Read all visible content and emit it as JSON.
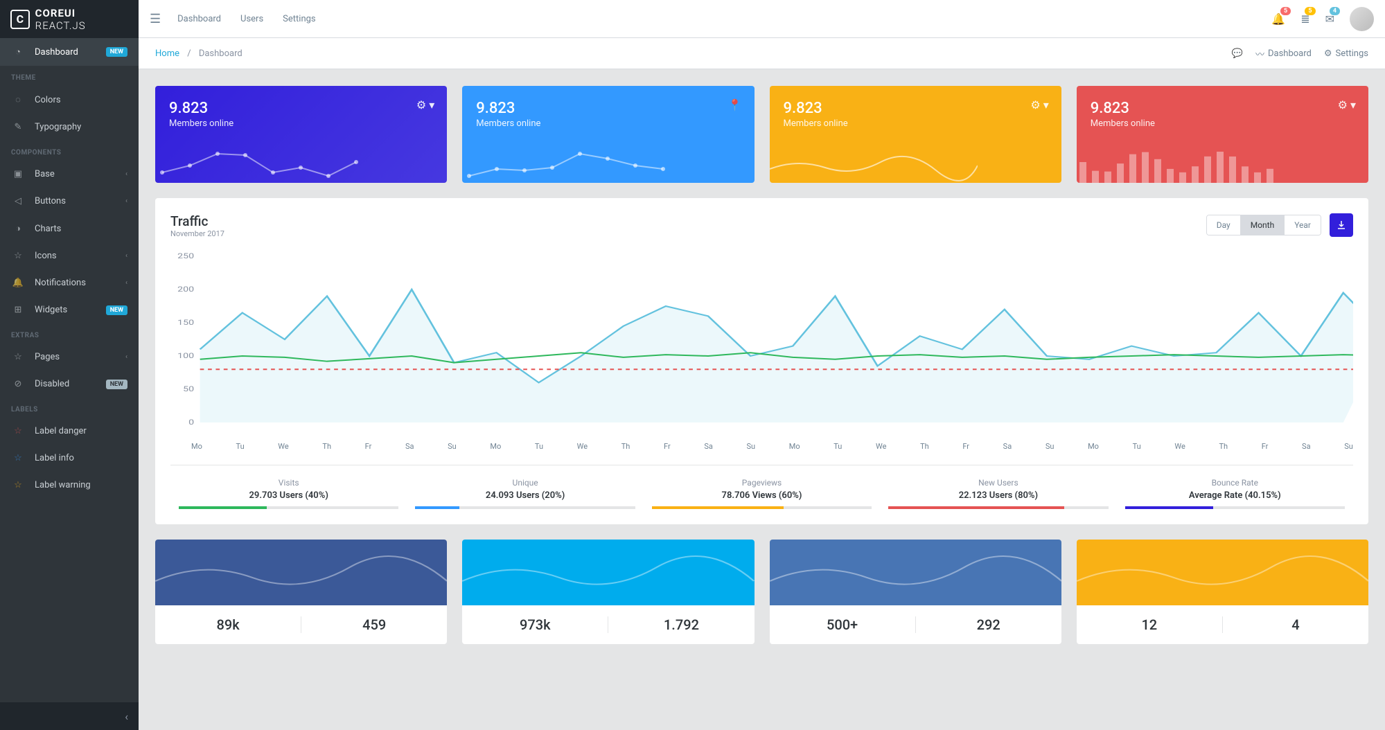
{
  "brand": {
    "main": "COREUI",
    "sub": "REACT.JS"
  },
  "headerNav": [
    "Dashboard",
    "Users",
    "Settings"
  ],
  "headerBadges": {
    "bell": "5",
    "list": "5",
    "mail": "4"
  },
  "breadcrumb": {
    "home": "Home",
    "current": "Dashboard"
  },
  "subheaderLinks": {
    "dash": "Dashboard",
    "settings": "Settings"
  },
  "sidebar": {
    "dashboard": {
      "label": "Dashboard",
      "badge": "NEW"
    },
    "sections": {
      "theme": "THEME",
      "components": "COMPONENTS",
      "extras": "EXTRAS",
      "labels": "LABELS"
    },
    "theme": [
      "Colors",
      "Typography"
    ],
    "components": [
      {
        "label": "Base",
        "chevron": true
      },
      {
        "label": "Buttons",
        "chevron": true
      },
      {
        "label": "Charts"
      },
      {
        "label": "Icons",
        "chevron": true
      },
      {
        "label": "Notifications",
        "chevron": true
      },
      {
        "label": "Widgets",
        "badge": "NEW"
      }
    ],
    "extras": [
      {
        "label": "Pages",
        "chevron": true
      },
      {
        "label": "Disabled",
        "badge": "NEW",
        "muted": true
      }
    ],
    "labels": [
      {
        "label": "Label danger",
        "color": "#e55353"
      },
      {
        "label": "Label info",
        "color": "#39f"
      },
      {
        "label": "Label warning",
        "color": "#f9b115"
      }
    ]
  },
  "cards": [
    {
      "value": "9.823",
      "label": "Members online",
      "cls": "blue",
      "icon": "gear"
    },
    {
      "value": "9.823",
      "label": "Members online",
      "cls": "lblue",
      "icon": "pin"
    },
    {
      "value": "9.823",
      "label": "Members online",
      "cls": "orange",
      "icon": "gear"
    },
    {
      "value": "9.823",
      "label": "Members online",
      "cls": "red",
      "icon": "gear"
    }
  ],
  "traffic": {
    "title": "Traffic",
    "subtitle": "November 2017",
    "buttons": [
      "Day",
      "Month",
      "Year"
    ],
    "active": "Month",
    "footer": [
      {
        "label": "Visits",
        "value": "29.703 Users (40%)",
        "color": "#2eb85c",
        "pct": 40
      },
      {
        "label": "Unique",
        "value": "24.093 Users (20%)",
        "color": "#39f",
        "pct": 20
      },
      {
        "label": "Pageviews",
        "value": "78.706 Views (60%)",
        "color": "#f9b115",
        "pct": 60
      },
      {
        "label": "New Users",
        "value": "22.123 Users (80%)",
        "color": "#e55353",
        "pct": 80
      },
      {
        "label": "Bounce Rate",
        "value": "Average Rate (40.15%)",
        "color": "#321fdb",
        "pct": 40
      }
    ]
  },
  "socials": [
    {
      "cls": "fb",
      "a": "89k",
      "b": "459"
    },
    {
      "cls": "tw",
      "a": "973k",
      "b": "1.792"
    },
    {
      "cls": "li",
      "a": "500+",
      "b": "292"
    },
    {
      "cls": "cal",
      "a": "12",
      "b": "4"
    }
  ],
  "chart_data": {
    "type": "line",
    "title": "Traffic",
    "xlabel": "",
    "ylabel": "",
    "ylim": [
      0,
      250
    ],
    "yticks": [
      0,
      50,
      100,
      150,
      200,
      250
    ],
    "categories": [
      "Mo",
      "Tu",
      "We",
      "Th",
      "Fr",
      "Sa",
      "Su",
      "Mo",
      "Tu",
      "We",
      "Th",
      "Fr",
      "Sa",
      "Su",
      "Mo",
      "Tu",
      "We",
      "Th",
      "Fr",
      "Sa",
      "Su",
      "Mo",
      "Tu",
      "We",
      "Th",
      "Fr",
      "Sa",
      "Su"
    ],
    "series": [
      {
        "name": "main",
        "color": "#63c2de",
        "fill": true,
        "values": [
          110,
          165,
          125,
          190,
          100,
          200,
          90,
          105,
          60,
          100,
          145,
          175,
          160,
          100,
          115,
          190,
          85,
          130,
          110,
          170,
          100,
          95,
          115,
          100,
          105,
          165,
          100,
          195,
          130
        ]
      },
      {
        "name": "secondary",
        "color": "#2eb85c",
        "values": [
          95,
          100,
          98,
          92,
          96,
          100,
          90,
          95,
          100,
          105,
          98,
          102,
          100,
          105,
          98,
          95,
          100,
          102,
          98,
          100,
          95,
          98,
          100,
          102,
          100,
          98,
          100,
          102,
          100
        ]
      },
      {
        "name": "threshold",
        "color": "#e55353",
        "dashed": true,
        "values": [
          80,
          80,
          80,
          80,
          80,
          80,
          80,
          80,
          80,
          80,
          80,
          80,
          80,
          80,
          80,
          80,
          80,
          80,
          80,
          80,
          80,
          80,
          80,
          80,
          80,
          80,
          80,
          80,
          80
        ]
      }
    ]
  }
}
